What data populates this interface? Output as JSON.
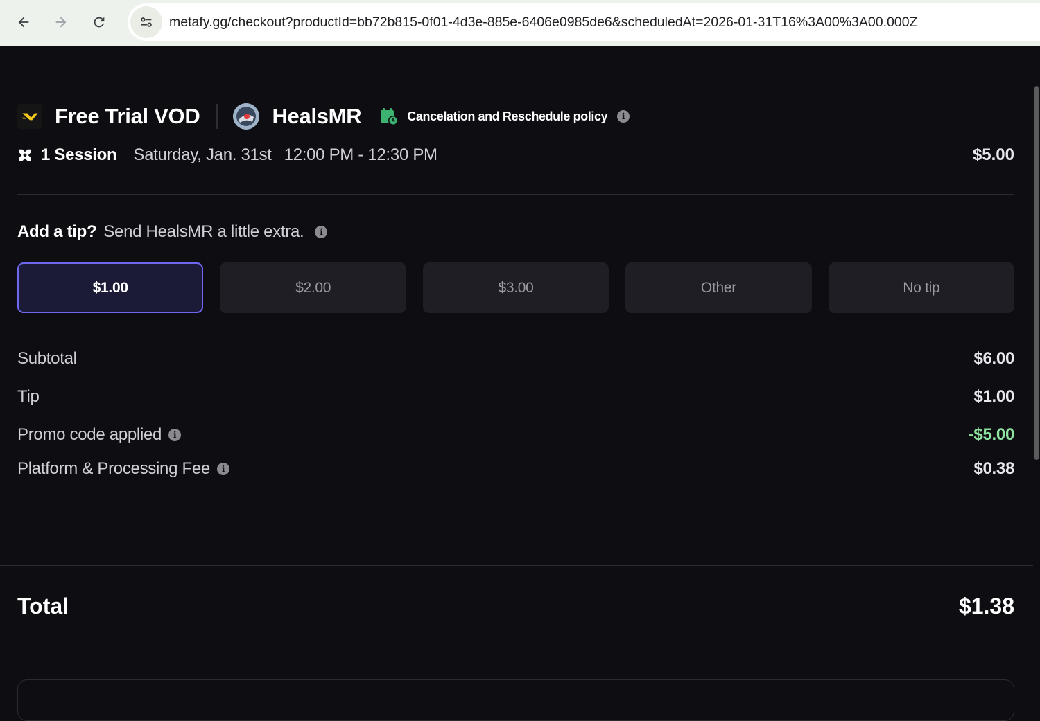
{
  "browser": {
    "url": "metafy.gg/checkout?productId=bb72b815-0f01-4d3e-885e-6406e0985de6&scheduledAt=2026-01-31T16%3A00%3A00.000Z",
    "back_icon": "arrow-left-icon",
    "forward_icon": "arrow-right-icon",
    "reload_icon": "reload-icon",
    "site_info_icon": "tune-icon"
  },
  "product": {
    "title": "Free Trial VOD",
    "coach_name": "HealsMR",
    "policy_label": "Cancelation and Reschedule policy"
  },
  "session": {
    "count_label": "1 Session",
    "date": "Saturday, Jan. 31st",
    "time": "12:00 PM - 12:30 PM",
    "price": "$5.00"
  },
  "tip": {
    "heading": "Add a tip?",
    "subheading": "Send HealsMR a little extra.",
    "options": [
      {
        "label": "$1.00",
        "selected": true
      },
      {
        "label": "$2.00",
        "selected": false
      },
      {
        "label": "$3.00",
        "selected": false
      },
      {
        "label": "Other",
        "selected": false
      },
      {
        "label": "No tip",
        "selected": false
      }
    ]
  },
  "summary": {
    "subtotal_label": "Subtotal",
    "subtotal_value": "$6.00",
    "tip_label": "Tip",
    "tip_value": "$1.00",
    "promo_label": "Promo code applied",
    "promo_value": "-$5.00",
    "fee_label": "Platform & Processing Fee",
    "fee_value": "$0.38"
  },
  "total": {
    "label": "Total",
    "value": "$1.38"
  },
  "colors": {
    "background": "#0e0e12",
    "selected_border": "#6e67f0",
    "discount": "#8fe3a0",
    "policy_icon": "#3cb371"
  }
}
